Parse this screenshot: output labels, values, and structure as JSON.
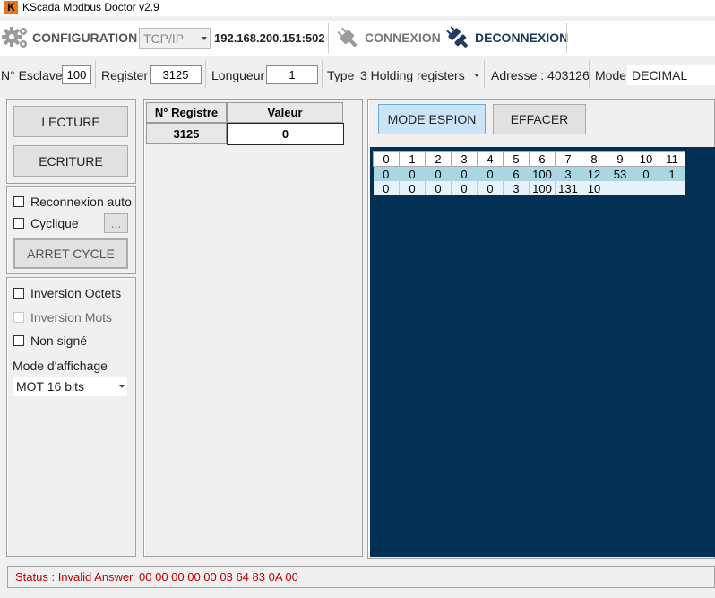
{
  "app": {
    "title": "KScada Modbus Doctor v2.9",
    "icon_letter": "K"
  },
  "toolbar": {
    "configuration_label": "CONFIGURATION",
    "protocol": "TCP/IP",
    "address": "192.168.200.151:502",
    "connect_label": "CONNEXION",
    "disconnect_label": "DECONNEXION"
  },
  "params": {
    "slave_label": "N° Esclave",
    "slave_value": "100",
    "register_label": "Register",
    "register_value": "3125",
    "length_label": "Longueur",
    "length_value": "1",
    "type_label": "Type",
    "type_value": "3 Holding registers",
    "address_label": "Adresse : 403126",
    "mode_label": "Mode",
    "mode_value": "DECIMAL"
  },
  "left": {
    "read_label": "LECTURE",
    "write_label": "ECRITURE",
    "auto_reconnect_label": "Reconnexion auto",
    "cyclic_label": "Cyclique",
    "ellipsis": "...",
    "stop_cycle_label": "ARRET CYCLE",
    "byte_swap_label": "Inversion Octets",
    "word_swap_label": "Inversion Mots",
    "unsigned_label": "Non signé",
    "display_mode_label": "Mode d'affichage",
    "display_mode_value": "MOT 16 bits"
  },
  "registers": {
    "col_register": "N° Registre",
    "col_value": "Valeur",
    "rows": [
      {
        "register": "3125",
        "value": "0"
      }
    ]
  },
  "spy": {
    "spy_mode_label": "MODE ESPION",
    "clear_label": "EFFACER",
    "headers": [
      "0",
      "1",
      "2",
      "3",
      "4",
      "5",
      "6",
      "7",
      "8",
      "9",
      "10",
      "11"
    ],
    "row1": [
      "0",
      "0",
      "0",
      "0",
      "0",
      "6",
      "100",
      "3",
      "12",
      "53",
      "0",
      "1"
    ],
    "row2": [
      "0",
      "0",
      "0",
      "0",
      "0",
      "3",
      "100",
      "131",
      "10"
    ]
  },
  "status": {
    "text": "Status : Invalid Answer, 00 00 00 00 00 03 64 83 0A 00"
  }
}
